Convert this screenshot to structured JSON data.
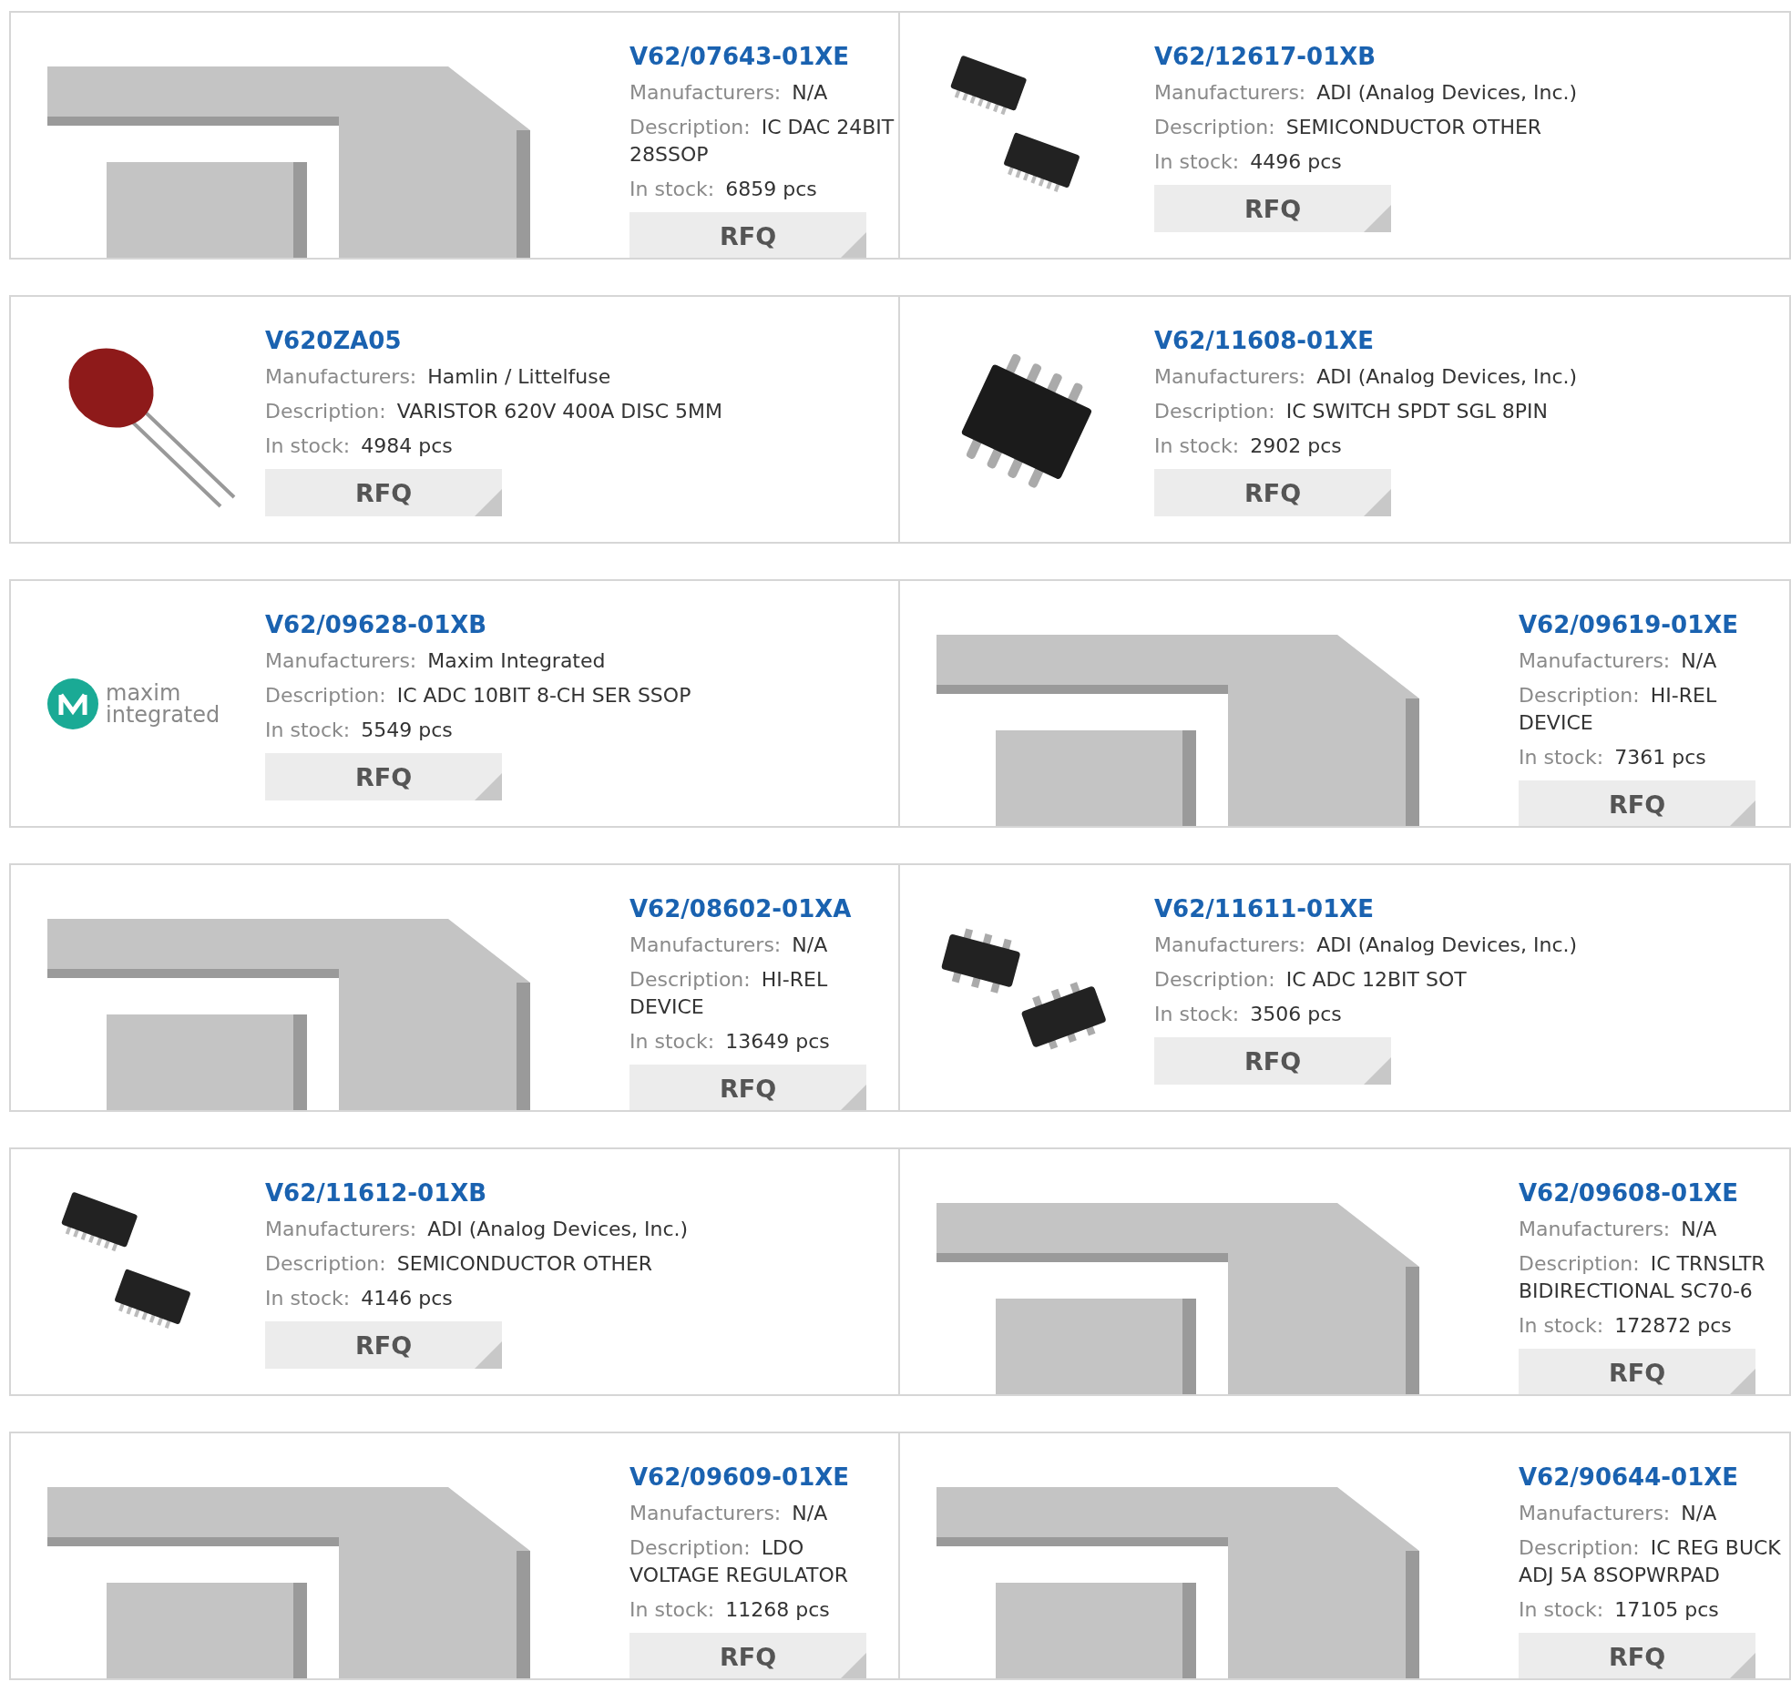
{
  "products": [
    {
      "part": "V62/07643-01XE",
      "image": {
        "kind": "placeholder"
      },
      "fields": [
        {
          "label": "Manufacturers:",
          "value": "N/A"
        },
        {
          "label": "Description:",
          "value": "IC DAC 24BIT 28SSOP"
        },
        {
          "label": "In stock:",
          "value": "6859 pcs"
        }
      ],
      "button": "RFQ"
    },
    {
      "part": "V62/12617-01XB",
      "image": {
        "kind": "soic-pair"
      },
      "fields": [
        {
          "label": "Manufacturers:",
          "value": "ADI (Analog Devices, Inc.)"
        },
        {
          "label": "Description:",
          "value": "SEMICONDUCTOR OTHER"
        },
        {
          "label": "In stock:",
          "value": "4496 pcs"
        }
      ],
      "button": "RFQ"
    },
    {
      "part": "V620ZA05",
      "image": {
        "kind": "varistor"
      },
      "fields": [
        {
          "label": "Manufacturers:",
          "value": "Hamlin / Littelfuse"
        },
        {
          "label": "Description:",
          "value": "VARISTOR 620V 400A DISC 5MM"
        },
        {
          "label": "In stock:",
          "value": "4984 pcs"
        }
      ],
      "button": "RFQ"
    },
    {
      "part": "V62/11608-01XE",
      "image": {
        "kind": "sot"
      },
      "fields": [
        {
          "label": "Manufacturers:",
          "value": "ADI (Analog Devices, Inc.)"
        },
        {
          "label": "Description:",
          "value": "IC SWITCH SPDT SGL 8PIN"
        },
        {
          "label": "In stock:",
          "value": "2902 pcs"
        }
      ],
      "button": "RFQ"
    },
    {
      "part": "V62/09628-01XB",
      "image": {
        "kind": "logo",
        "words": [
          "maxim",
          "integrated"
        ]
      },
      "fields": [
        {
          "label": "Manufacturers:",
          "value": "Maxim Integrated"
        },
        {
          "label": "Description:",
          "value": "IC ADC 10BIT 8-CH SER SSOP"
        },
        {
          "label": "In stock:",
          "value": "5549 pcs"
        }
      ],
      "button": "RFQ"
    },
    {
      "part": "V62/09619-01XE",
      "image": {
        "kind": "placeholder"
      },
      "fields": [
        {
          "label": "Manufacturers:",
          "value": "N/A"
        },
        {
          "label": "Description:",
          "value": "HI-REL DEVICE"
        },
        {
          "label": "In stock:",
          "value": "7361 pcs"
        }
      ],
      "button": "RFQ"
    },
    {
      "part": "V62/08602-01XA",
      "image": {
        "kind": "placeholder"
      },
      "fields": [
        {
          "label": "Manufacturers:",
          "value": "N/A"
        },
        {
          "label": "Description:",
          "value": "HI-REL DEVICE"
        },
        {
          "label": "In stock:",
          "value": "13649 pcs"
        }
      ],
      "button": "RFQ"
    },
    {
      "part": "V62/11611-01XE",
      "image": {
        "kind": "sot-pair"
      },
      "fields": [
        {
          "label": "Manufacturers:",
          "value": "ADI (Analog Devices, Inc.)"
        },
        {
          "label": "Description:",
          "value": "IC ADC 12BIT SOT"
        },
        {
          "label": "In stock:",
          "value": "3506 pcs"
        }
      ],
      "button": "RFQ"
    },
    {
      "part": "V62/11612-01XB",
      "image": {
        "kind": "soic-pair"
      },
      "fields": [
        {
          "label": "Manufacturers:",
          "value": "ADI (Analog Devices, Inc.)"
        },
        {
          "label": "Description:",
          "value": "SEMICONDUCTOR OTHER"
        },
        {
          "label": "In stock:",
          "value": "4146 pcs"
        }
      ],
      "button": "RFQ"
    },
    {
      "part": "V62/09608-01XE",
      "image": {
        "kind": "placeholder"
      },
      "fields": [
        {
          "label": "Manufacturers:",
          "value": "N/A"
        },
        {
          "label": "Description:",
          "value": "IC TRNSLTR BIDIRECTIONAL SC70-6"
        },
        {
          "label": "In stock:",
          "value": "172872 pcs"
        }
      ],
      "button": "RFQ"
    },
    {
      "part": "V62/09609-01XE",
      "image": {
        "kind": "placeholder"
      },
      "fields": [
        {
          "label": "Manufacturers:",
          "value": "N/A"
        },
        {
          "label": "Description:",
          "value": "LDO VOLTAGE REGULATOR"
        },
        {
          "label": "In stock:",
          "value": "11268 pcs"
        }
      ],
      "button": "RFQ"
    },
    {
      "part": "V62/90644-01XE",
      "image": {
        "kind": "placeholder"
      },
      "fields": [
        {
          "label": "Manufacturers:",
          "value": "N/A"
        },
        {
          "label": "Description:",
          "value": "IC REG BUCK ADJ 5A 8SOPWRPAD"
        },
        {
          "label": "In stock:",
          "value": "17105 pcs"
        }
      ],
      "button": "RFQ"
    }
  ]
}
